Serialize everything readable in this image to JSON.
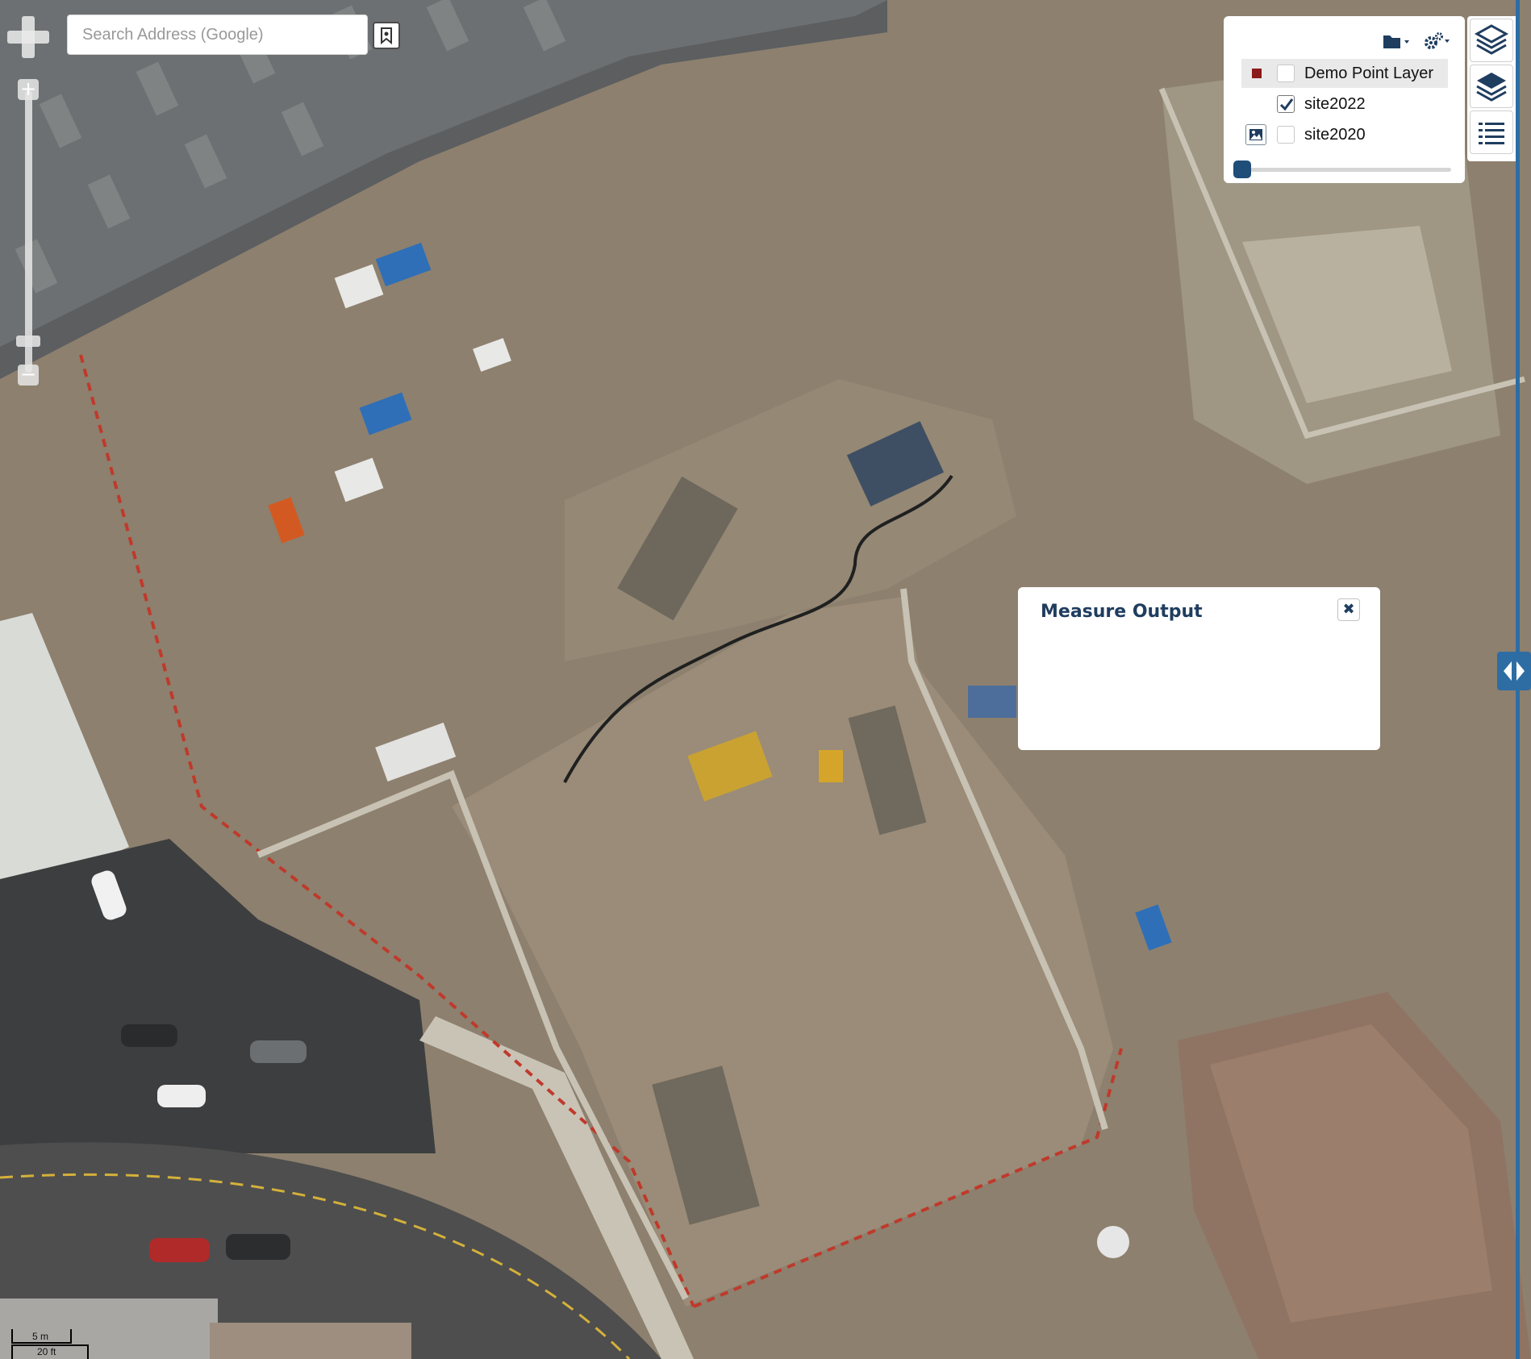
{
  "search": {
    "placeholder": "Search Address (Google)"
  },
  "zoom": {
    "plus_label": "+",
    "minus_label": "−"
  },
  "layers": {
    "items": [
      {
        "label": "Demo Point Layer",
        "checked": false,
        "swatch_color": "#8b1a1a"
      },
      {
        "label": "site2022",
        "checked": true
      },
      {
        "label": "site2020",
        "checked": false
      }
    ],
    "opacity": 0
  },
  "measure": {
    "title": "Measure Output",
    "close_label": "✖"
  },
  "scale": {
    "metric": "5 m",
    "imperial": "20 ft"
  },
  "colors": {
    "accent": "#2e6da4",
    "title_blue": "#1f3d5f",
    "swatch": "#8b1a1a"
  },
  "icons": {
    "pan": "pan-arrows-icon",
    "bookmark": "bookmark-icon",
    "folder": "folder-icon",
    "settings": "gear-icon",
    "layers_outline": "layers-outline-icon",
    "layers_filled": "layers-filled-icon",
    "legend": "list-icon",
    "collapse": "arrow-left-right-icon"
  }
}
